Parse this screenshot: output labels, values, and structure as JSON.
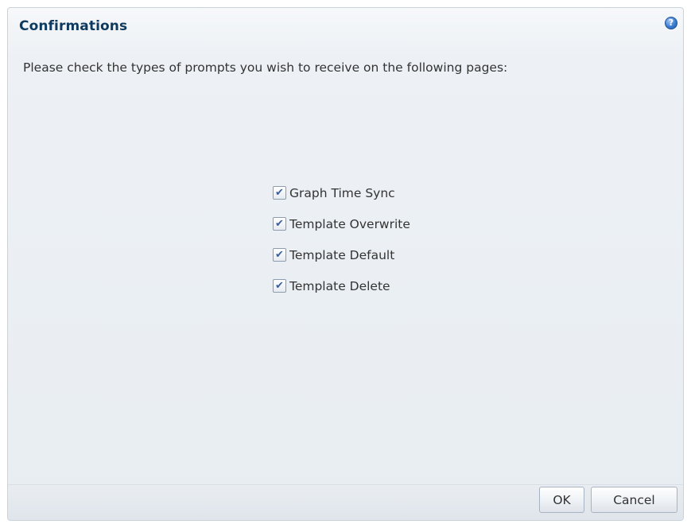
{
  "dialog": {
    "title": "Confirmations",
    "help_icon": "question-mark-icon",
    "help_glyph": "?",
    "instructions": "Please check the types of prompts you wish to receive on the following pages:"
  },
  "options": [
    {
      "label": "Graph Time Sync",
      "checked": true
    },
    {
      "label": "Template Overwrite",
      "checked": true
    },
    {
      "label": "Template Default",
      "checked": true
    },
    {
      "label": "Template Delete",
      "checked": true
    }
  ],
  "buttons": {
    "ok_label": "OK",
    "cancel_label": "Cancel"
  },
  "colors": {
    "title": "#0d3a5e",
    "help_icon": "#3c7dd1",
    "text": "#333333",
    "checkmark": "#3c5f99"
  }
}
